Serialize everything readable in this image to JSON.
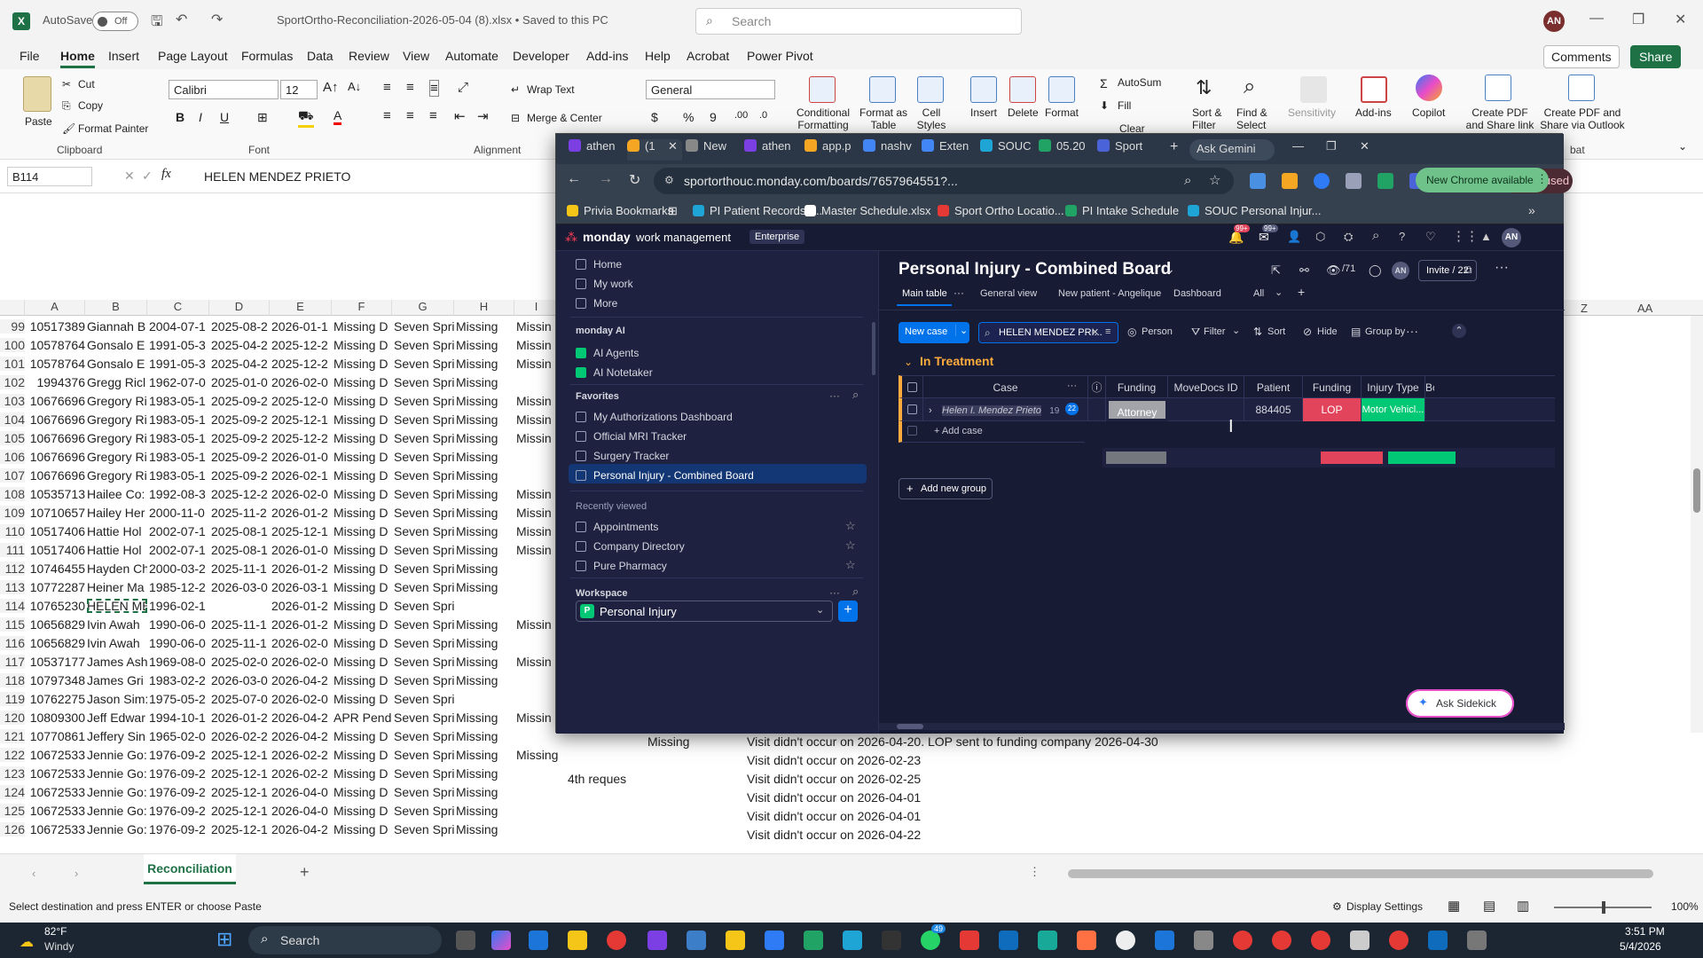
{
  "excel": {
    "title_bar": {
      "autosave_label": "AutoSave",
      "autosave_state": "Off",
      "file_title": "SportOrtho-Reconciliation-2026-05-04 (8).xlsx • Saved to this PC",
      "search_placeholder": "Search",
      "user_initials": "AN"
    },
    "menu_tabs": [
      "File",
      "Home",
      "Insert",
      "Page Layout",
      "Formulas",
      "Data",
      "Review",
      "View",
      "Automate",
      "Developer",
      "Add-ins",
      "Help",
      "Acrobat",
      "Power Pivot"
    ],
    "comments_label": "Comments",
    "share_label": "Share",
    "ribbon": {
      "paste": "Paste",
      "cut": "Cut",
      "copy": "Copy",
      "format_painter": "Format Painter",
      "clipboard": "Clipboard",
      "font_name": "Calibri",
      "font_size": "12",
      "font_group": "Font",
      "wrap_text": "Wrap Text",
      "merge_center": "Merge & Center",
      "alignment": "Alignment",
      "number_format": "General",
      "conditional_formatting": "Conditional Formatting",
      "format_as_table": "Format as Table",
      "cell_styles": "Cell Styles",
      "insert": "Insert",
      "delete": "Delete",
      "format": "Format",
      "autosum": "AutoSum",
      "fill": "Fill",
      "clear": "Clear",
      "sort_filter": "Sort & Filter",
      "find_select": "Find & Select",
      "sensitivity": "Sensitivity",
      "add_ins": "Add-ins",
      "copilot": "Copilot",
      "create_pdf_share": "Create PDF and Share link",
      "create_pdf_outlook": "Create PDF and Share via Outlook",
      "bat": "bat"
    },
    "name_box": "B114",
    "formula_value": "HELEN MENDEZ PRIETO",
    "columns": [
      "A",
      "B",
      "C",
      "D",
      "E",
      "F",
      "G",
      "H",
      "I"
    ],
    "right_columns": [
      "Z",
      "AA"
    ],
    "rows": [
      {
        "n": "99",
        "a": "10517389",
        "b": "Giannah B",
        "c": "2004-07-1",
        "d": "2025-08-2",
        "e": "2026-01-1",
        "f": "Missing D",
        "g": "Seven Spri",
        "h": "Missing",
        "i": "Missin"
      },
      {
        "n": "100",
        "a": "10578764",
        "b": "Gonsalo E",
        "c": "1991-05-3",
        "d": "2025-04-2",
        "e": "2025-12-2",
        "f": "Missing D",
        "g": "Seven Spri",
        "h": "Missing",
        "i": "Missin"
      },
      {
        "n": "101",
        "a": "10578764",
        "b": "Gonsalo E",
        "c": "1991-05-3",
        "d": "2025-04-2",
        "e": "2025-12-2",
        "f": "Missing D",
        "g": "Seven Spri",
        "h": "Missing",
        "i": "Missin"
      },
      {
        "n": "102",
        "a": "1994376",
        "b": "Gregg Ricl",
        "c": "1962-07-0",
        "d": "2025-01-0",
        "e": "2026-02-0",
        "f": "Missing D",
        "g": "Seven Spri",
        "h": "Missing",
        "i": ""
      },
      {
        "n": "103",
        "a": "10676696",
        "b": "Gregory Ri",
        "c": "1983-05-1",
        "d": "2025-09-2",
        "e": "2025-12-0",
        "f": "Missing D",
        "g": "Seven Spri",
        "h": "Missing",
        "i": "Missin"
      },
      {
        "n": "104",
        "a": "10676696",
        "b": "Gregory Ri",
        "c": "1983-05-1",
        "d": "2025-09-2",
        "e": "2025-12-1",
        "f": "Missing D",
        "g": "Seven Spri",
        "h": "Missing",
        "i": "Missin"
      },
      {
        "n": "105",
        "a": "10676696",
        "b": "Gregory Ri",
        "c": "1983-05-1",
        "d": "2025-09-2",
        "e": "2025-12-2",
        "f": "Missing D",
        "g": "Seven Spri",
        "h": "Missing",
        "i": "Missin"
      },
      {
        "n": "106",
        "a": "10676696",
        "b": "Gregory Ri",
        "c": "1983-05-1",
        "d": "2025-09-2",
        "e": "2026-01-0",
        "f": "Missing D",
        "g": "Seven Spri",
        "h": "Missing",
        "i": ""
      },
      {
        "n": "107",
        "a": "10676696",
        "b": "Gregory Ri",
        "c": "1983-05-1",
        "d": "2025-09-2",
        "e": "2026-02-1",
        "f": "Missing D",
        "g": "Seven Spri",
        "h": "Missing",
        "i": ""
      },
      {
        "n": "108",
        "a": "10535713",
        "b": "Hailee Co:",
        "c": "1992-08-3",
        "d": "2025-12-2",
        "e": "2026-02-0",
        "f": "Missing D",
        "g": "Seven Spri",
        "h": "Missing",
        "i": "Missin"
      },
      {
        "n": "109",
        "a": "10710657",
        "b": "Hailey Her",
        "c": "2000-11-0",
        "d": "2025-11-2",
        "e": "2026-01-2",
        "f": "Missing D",
        "g": "Seven Spri",
        "h": "Missing",
        "i": "Missin"
      },
      {
        "n": "110",
        "a": "10517406",
        "b": "Hattie Hol",
        "c": "2002-07-1",
        "d": "2025-08-1",
        "e": "2025-12-1",
        "f": "Missing D",
        "g": "Seven Spri",
        "h": "Missing",
        "i": "Missin"
      },
      {
        "n": "111",
        "a": "10517406",
        "b": "Hattie Hol",
        "c": "2002-07-1",
        "d": "2025-08-1",
        "e": "2026-01-0",
        "f": "Missing D",
        "g": "Seven Spri",
        "h": "Missing",
        "i": "Missin"
      },
      {
        "n": "112",
        "a": "10746455",
        "b": "Hayden Ch",
        "c": "2000-03-2",
        "d": "2025-11-1",
        "e": "2026-01-2",
        "f": "Missing D",
        "g": "Seven Spri",
        "h": "Missing",
        "i": ""
      },
      {
        "n": "113",
        "a": "10772287",
        "b": "Heiner Ma",
        "c": "1985-12-2",
        "d": "2026-03-0",
        "e": "2026-03-1",
        "f": "Missing D",
        "g": "Seven Spri",
        "h": "Missing",
        "i": ""
      },
      {
        "n": "114",
        "a": "10765230",
        "b": "HELEN ME",
        "c": "1996-02-1",
        "d": "",
        "e": "2026-01-2",
        "f": "Missing D",
        "g": "Seven Spri",
        "h": "",
        "i": ""
      },
      {
        "n": "115",
        "a": "10656829",
        "b": "Ivin Awah",
        "c": "1990-06-0",
        "d": "2025-11-1",
        "e": "2026-01-2",
        "f": "Missing D",
        "g": "Seven Spri",
        "h": "Missing",
        "i": "Missin"
      },
      {
        "n": "116",
        "a": "10656829",
        "b": "Ivin Awah",
        "c": "1990-06-0",
        "d": "2025-11-1",
        "e": "2026-02-0",
        "f": "Missing D",
        "g": "Seven Spri",
        "h": "Missing",
        "i": ""
      },
      {
        "n": "117",
        "a": "10537177",
        "b": "James Ash",
        "c": "1969-08-0",
        "d": "2025-02-0",
        "e": "2026-02-0",
        "f": "Missing D",
        "g": "Seven Spri",
        "h": "Missing",
        "i": "Missin"
      },
      {
        "n": "118",
        "a": "10797348",
        "b": "James Gri",
        "c": "1983-02-2",
        "d": "2026-03-0",
        "e": "2026-04-2",
        "f": "Missing D",
        "g": "Seven Spri",
        "h": "Missing",
        "i": ""
      },
      {
        "n": "119",
        "a": "10762275",
        "b": "Jason Sim:",
        "c": "1975-05-2",
        "d": "2025-07-0",
        "e": "2026-02-0",
        "f": "Missing D",
        "g": "Seven Spri",
        "h": "",
        "i": ""
      },
      {
        "n": "120",
        "a": "10809300",
        "b": "Jeff Edwar",
        "c": "1994-10-1",
        "d": "2026-01-2",
        "e": "2026-04-2",
        "f": "APR Pendi",
        "g": "Seven Spri",
        "h": "Missing",
        "i": "Missin"
      },
      {
        "n": "121",
        "a": "10770861",
        "b": "Jeffery Sin",
        "c": "1965-02-0",
        "d": "2026-02-2",
        "e": "2026-04-2",
        "f": "Missing D",
        "g": "Seven Spri",
        "h": "Missing",
        "i": ""
      },
      {
        "n": "122",
        "a": "10672533",
        "b": "Jennie Go:",
        "c": "1976-09-2",
        "d": "2025-12-1",
        "e": "2026-02-2",
        "f": "Missing D",
        "g": "Seven Spri",
        "h": "Missing",
        "i": "Missing"
      },
      {
        "n": "123",
        "a": "10672533",
        "b": "Jennie Go:",
        "c": "1976-09-2",
        "d": "2025-12-1",
        "e": "2026-02-2",
        "f": "Missing D",
        "g": "Seven Spri",
        "h": "Missing",
        "i": ""
      },
      {
        "n": "124",
        "a": "10672533",
        "b": "Jennie Go:",
        "c": "1976-09-2",
        "d": "2025-12-1",
        "e": "2026-04-0",
        "f": "Missing D",
        "g": "Seven Spri",
        "h": "Missing",
        "i": ""
      },
      {
        "n": "125",
        "a": "10672533",
        "b": "Jennie Go:",
        "c": "1976-09-2",
        "d": "2025-12-1",
        "e": "2026-04-0",
        "f": "Missing D",
        "g": "Seven Spri",
        "h": "Missing",
        "i": ""
      },
      {
        "n": "126",
        "a": "10672533",
        "b": "Jennie Go:",
        "c": "1976-09-2",
        "d": "2025-12-1",
        "e": "2026-04-2",
        "f": "Missing D",
        "g": "Seven Spri",
        "h": "Missing",
        "i": ""
      }
    ],
    "lower_rows": [
      {
        "k": "",
        "m": "Missing",
        "v": "Visit didn't occur on 2026-04-20. LOP sent to funding company 2026-04-30"
      },
      {
        "k": "",
        "m": "",
        "v": "Visit didn't occur on 2026-02-23"
      },
      {
        "k": "4th reques",
        "m": "",
        "v": "Visit didn't occur on 2026-02-25"
      },
      {
        "k": "",
        "m": "",
        "v": "Visit didn't occur on 2026-04-01"
      },
      {
        "k": "",
        "m": "",
        "v": "Visit didn't occur on 2026-04-01"
      },
      {
        "k": "",
        "m": "",
        "v": "Visit didn't occur on 2026-04-22"
      }
    ],
    "sheet_tab": "Reconciliation",
    "status_text": "Select destination and press ENTER or choose Paste",
    "display_settings": "Display Settings",
    "zoom": "100%"
  },
  "chrome": {
    "tabs": [
      {
        "label": "athen",
        "color": "#7b3fe4"
      },
      {
        "label": "(1",
        "color": "#f5a623"
      },
      {
        "label": "New",
        "color": "#888888"
      },
      {
        "label": "athen",
        "color": "#7b3fe4"
      },
      {
        "label": "app.p",
        "color": "#f5a623"
      },
      {
        "label": "nashv",
        "color": "#4285f4"
      },
      {
        "label": "Exten",
        "color": "#4285f4"
      },
      {
        "label": "SOUC",
        "color": "#1ea5d6"
      },
      {
        "label": "05.20",
        "color": "#21a366"
      },
      {
        "label": "Sport",
        "color": "#4a63d9"
      }
    ],
    "ask_gemini": "Ask Gemini",
    "url": "sportorthouc.monday.com/boards/7657964551?...",
    "profile_status": "Paused",
    "profile_initial": "A",
    "update_label": "New Chrome available",
    "bookmarks": [
      {
        "label": "Privia Bookmarks",
        "color": "#f5c518"
      },
      {
        "label": "PI Patient Records -...",
        "color": "#1ea5d6"
      },
      {
        "label": "Master Schedule.xlsx",
        "color": "#ffffff"
      },
      {
        "label": "Sport Ortho Locatio...",
        "color": "#e53935"
      },
      {
        "label": "PI Intake Schedule",
        "color": "#21a366"
      },
      {
        "label": "SOUC Personal Injur...",
        "color": "#1ea5d6"
      }
    ]
  },
  "monday": {
    "brand": "monday",
    "brand_sub": "work management",
    "plan": "Enterprise",
    "notif_count": "99+",
    "inbox_count": "99+",
    "user_initials": "AN",
    "nav": [
      "Home",
      "My work",
      "More"
    ],
    "ai_header": "monday AI",
    "ai_items": [
      "AI Agents",
      "AI Notetaker"
    ],
    "favorites_header": "Favorites",
    "favorites": [
      "My Authorizations Dashboard",
      "Official MRI Tracker",
      "Surgery Tracker",
      "Personal Injury - Combined Board"
    ],
    "recent_header": "Recently viewed",
    "recent": [
      "Appointments",
      "Company Directory",
      "Pure Pharmacy"
    ],
    "workspace_header": "Workspace",
    "workspace_name": "Personal Injury",
    "workspace_initial": "P",
    "board_title": "Personal Injury - Combined Board",
    "viewer_count": "/71",
    "invite_label": "Invite / 22",
    "views": [
      "Main table",
      "General view",
      "New patient - Angelique",
      "Dashboard",
      "All"
    ],
    "new_case": "New case",
    "search_value": "HELEN MENDEZ PRI...",
    "toolbar": [
      "Person",
      "Filter",
      "Sort",
      "Hide",
      "Group by"
    ],
    "group_name": "In Treatment",
    "columns": [
      "Case",
      "Funding Co...",
      "MoveDocs ID",
      "Patient MRN",
      "Funding Met...",
      "Injury Type",
      "Bo"
    ],
    "item": {
      "name": "Helen I. Mendez Prieto",
      "number": "19",
      "updates": "22",
      "funding_company": "Attorney",
      "movedocs_id": "",
      "patient_mrn": "884405",
      "funding_method": "LOP",
      "injury_type": "Motor Vehicl..."
    },
    "add_item": "+ Add case",
    "add_group": "Add new group",
    "sidekick": "Ask Sidekick",
    "colors": {
      "funding_bg": "#a2a4aa",
      "lop": "#e2445c",
      "injury": "#00c875",
      "accent": "#0073ea",
      "group": "#fdab3d"
    }
  },
  "taskbar": {
    "weather_temp": "82°F",
    "weather_desc": "Windy",
    "search_placeholder": "Search",
    "time": "3:51 PM",
    "date": "5/4/2026",
    "whatsapp_badge": "49"
  }
}
